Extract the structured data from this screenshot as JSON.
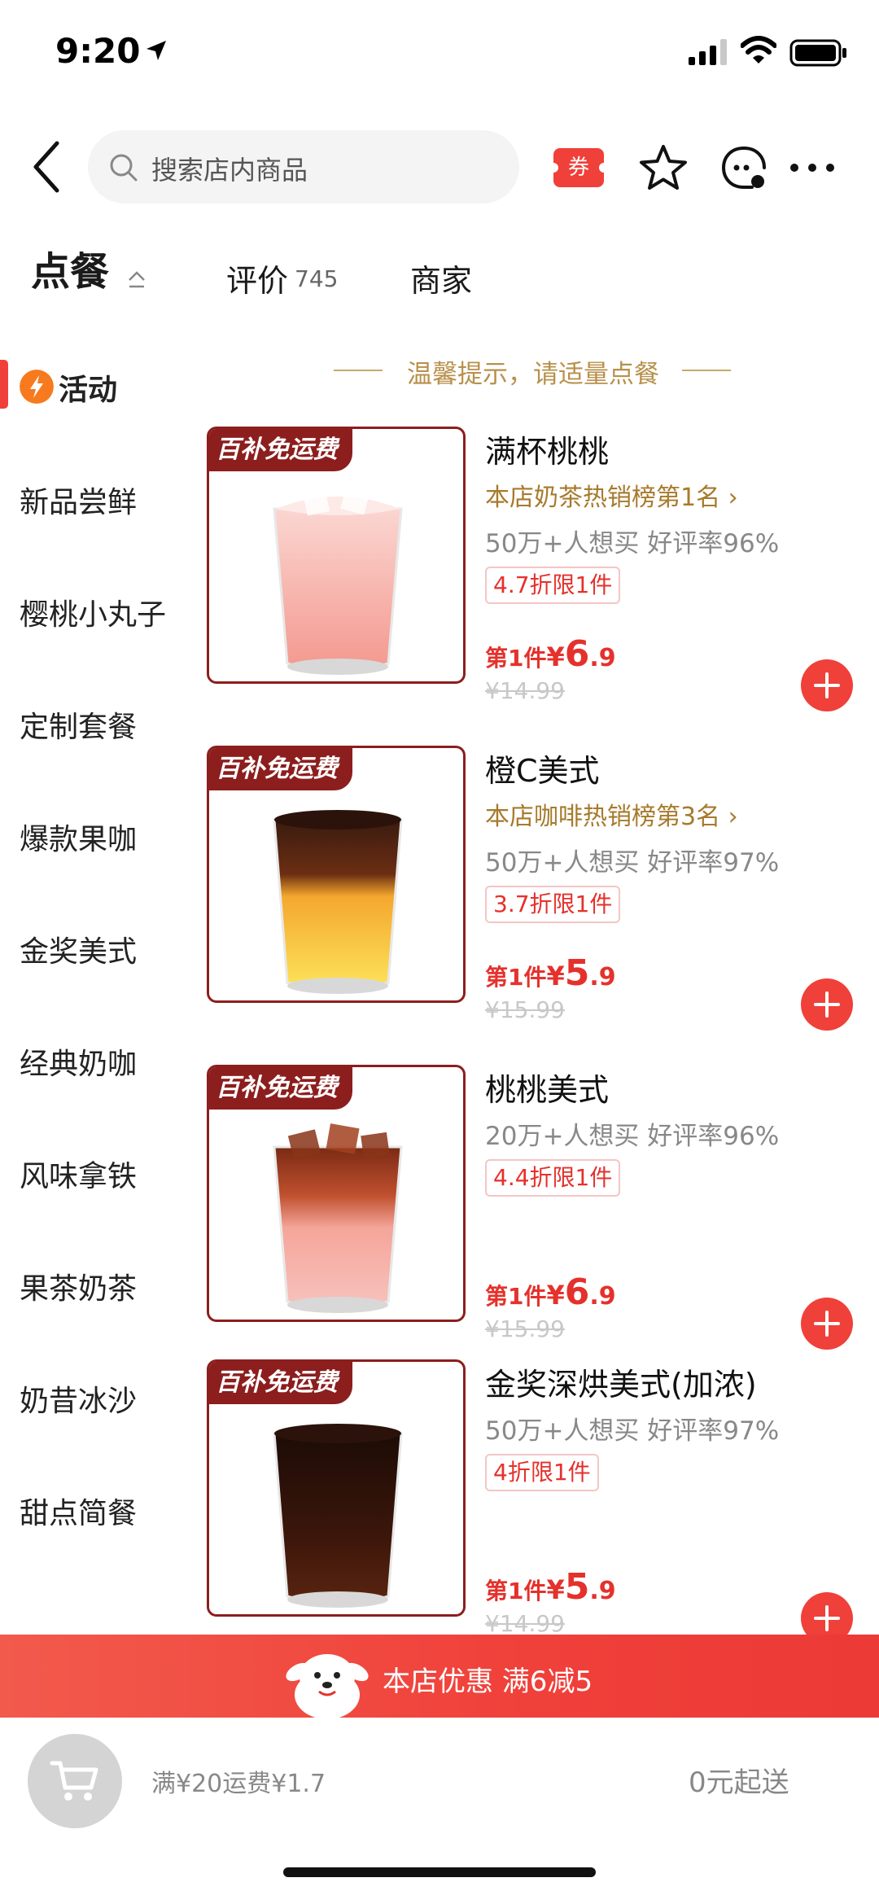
{
  "status_bar": {
    "time": "9:20"
  },
  "search": {
    "placeholder": "搜索店内商品"
  },
  "nav": {
    "coupon_label": "券"
  },
  "tabs": {
    "order": "点餐",
    "reviews": "评价",
    "reviews_count": "745",
    "merchant": "商家"
  },
  "tip": "温馨提示，请适量点餐",
  "sidebar": {
    "items": [
      "活动",
      "新品尝鲜",
      "樱桃小丸子",
      "定制套餐",
      "爆款果咖",
      "金奖美式",
      "经典奶咖",
      "风味拿铁",
      "果茶奶茶",
      "奶昔冰沙",
      "甜点简餐"
    ]
  },
  "products": [
    {
      "badge": "百补免运费",
      "name": "满杯桃桃",
      "rank": "本店奶茶热销榜第1名 ›",
      "stats": "50万+人想买  好评率96%",
      "discount": "4.7折限1件",
      "price_prefix": "第1件",
      "currency": "¥",
      "price_int": "6",
      "price_dec": ".9",
      "original_price": "¥14.99",
      "cup": "peach"
    },
    {
      "badge": "百补免运费",
      "name": "橙C美式",
      "rank": "本店咖啡热销榜第3名 ›",
      "stats": "50万+人想买  好评率97%",
      "discount": "3.7折限1件",
      "price_prefix": "第1件",
      "currency": "¥",
      "price_int": "5",
      "price_dec": ".9",
      "original_price": "¥15.99",
      "cup": "orange"
    },
    {
      "badge": "百补免运费",
      "name": "桃桃美式",
      "rank": "",
      "stats": "20万+人想买  好评率96%",
      "discount": "4.4折限1件",
      "price_prefix": "第1件",
      "currency": "¥",
      "price_int": "6",
      "price_dec": ".9",
      "original_price": "¥15.99",
      "cup": "peach-coffee"
    },
    {
      "badge": "百补免运费",
      "name": "金奖深烘美式(加浓)",
      "rank": "",
      "stats": "50万+人想买  好评率97%",
      "discount": "4折限1件",
      "price_prefix": "第1件",
      "currency": "¥",
      "price_int": "5",
      "price_dec": ".9",
      "original_price": "¥14.99",
      "cup": "black"
    }
  ],
  "promo": {
    "text": "本店优惠  满6减5"
  },
  "cart": {
    "shipping": "满¥20运费¥1.7",
    "min_order": "0元起送"
  },
  "colors": {
    "accent": "#f0403a",
    "badge": "#8c1e1e",
    "price": "#e5312c",
    "rank": "#a77a2c"
  }
}
